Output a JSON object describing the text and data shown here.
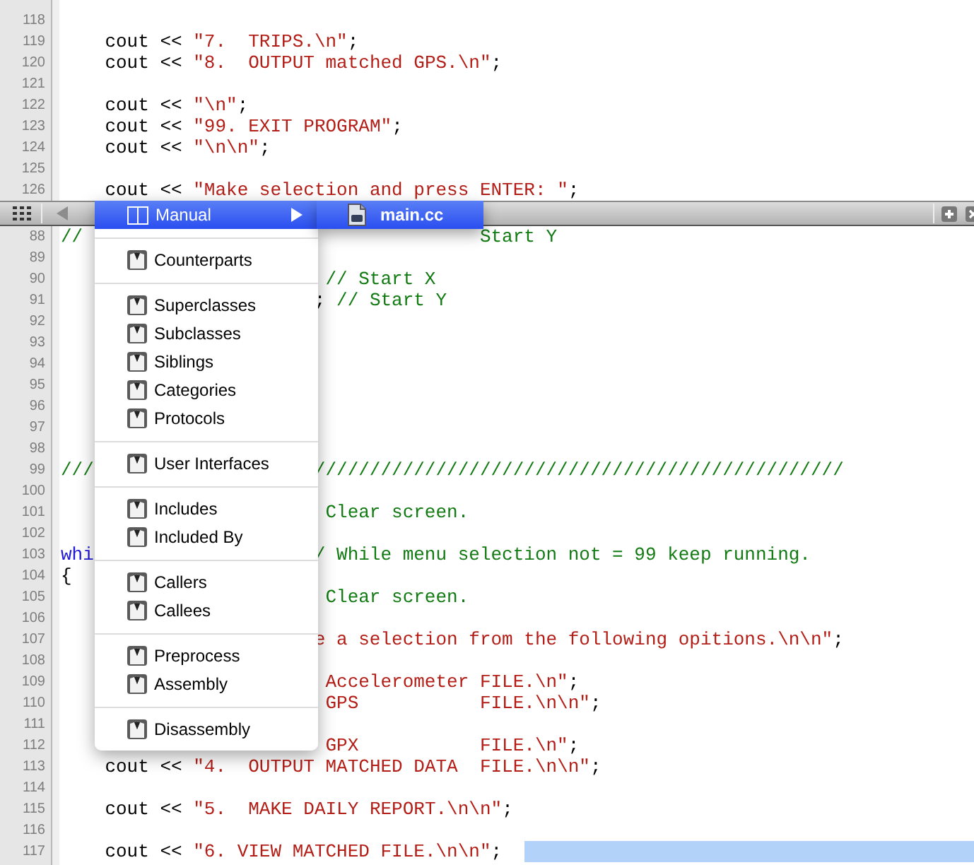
{
  "editor_top": {
    "lines": [
      {
        "number": "118"
      },
      {
        "number": "119",
        "indented": true,
        "segments": [
          {
            "kind": "plain",
            "text": "cout << "
          },
          {
            "kind": "string",
            "text": "\"7.  TRIPS.\\n\""
          },
          {
            "kind": "plain",
            "text": ";"
          }
        ]
      },
      {
        "number": "120",
        "indented": true,
        "segments": [
          {
            "kind": "plain",
            "text": "cout << "
          },
          {
            "kind": "string",
            "text": "\"8.  OUTPUT matched GPS.\\n\""
          },
          {
            "kind": "plain",
            "text": ";"
          }
        ]
      },
      {
        "number": "121"
      },
      {
        "number": "122",
        "indented": true,
        "segments": [
          {
            "kind": "plain",
            "text": "cout << "
          },
          {
            "kind": "string",
            "text": "\"\\n\""
          },
          {
            "kind": "plain",
            "text": ";"
          }
        ]
      },
      {
        "number": "123",
        "indented": true,
        "segments": [
          {
            "kind": "plain",
            "text": "cout << "
          },
          {
            "kind": "string",
            "text": "\"99. EXIT PROGRAM\""
          },
          {
            "kind": "plain",
            "text": ";"
          }
        ]
      },
      {
        "number": "124",
        "indented": true,
        "segments": [
          {
            "kind": "plain",
            "text": "cout << "
          },
          {
            "kind": "string",
            "text": "\"\\n\\n\""
          },
          {
            "kind": "plain",
            "text": ";"
          }
        ]
      },
      {
        "number": "125"
      },
      {
        "number": "126",
        "indented": true,
        "segments": [
          {
            "kind": "plain",
            "text": "cout << "
          },
          {
            "kind": "string",
            "text": "\"Make selection and press ENTER: \""
          },
          {
            "kind": "plain",
            "text": ";"
          }
        ]
      }
    ]
  },
  "editor_bottom": {
    "lines": [
      {
        "number": "88",
        "segments": [
          {
            "kind": "comment",
            "text": "//"
          }
        ],
        "after_submenu": [
          {
            "kind": "comment",
            "text": "Start Y"
          }
        ]
      },
      {
        "number": "89"
      },
      {
        "number": "90",
        "after_menu": [
          {
            "kind": "comment",
            "text": " // Start X"
          }
        ]
      },
      {
        "number": "91",
        "after_menu": [
          {
            "kind": "plain",
            "text": ";"
          },
          {
            "kind": "comment",
            "text": " // Start Y"
          }
        ]
      },
      {
        "number": "92"
      },
      {
        "number": "93"
      },
      {
        "number": "94"
      },
      {
        "number": "95"
      },
      {
        "number": "96"
      },
      {
        "number": "97"
      },
      {
        "number": "98"
      },
      {
        "number": "99",
        "segments": [
          {
            "kind": "comment",
            "text": "///"
          }
        ],
        "after_menu": [
          {
            "kind": "comment",
            "text": "////////////////////////////////////////////////"
          }
        ]
      },
      {
        "number": "100"
      },
      {
        "number": "101",
        "after_menu": [
          {
            "kind": "comment",
            "text": " Clear screen."
          }
        ]
      },
      {
        "number": "102"
      },
      {
        "number": "103",
        "segments": [
          {
            "kind": "keyword",
            "text": "whi"
          }
        ],
        "after_menu": [
          {
            "kind": "comment",
            "text": "/ While menu selection not = 99 keep running."
          }
        ]
      },
      {
        "number": "104",
        "segments": [
          {
            "kind": "plain",
            "text": "{"
          }
        ]
      },
      {
        "number": "105",
        "after_menu": [
          {
            "kind": "comment",
            "text": " Clear screen."
          }
        ]
      },
      {
        "number": "106"
      },
      {
        "number": "107",
        "after_menu": [
          {
            "kind": "string",
            "text": "e a selection from the following opitions.\\n\\n\""
          },
          {
            "kind": "plain",
            "text": ";"
          }
        ]
      },
      {
        "number": "108"
      },
      {
        "number": "109",
        "after_menu": [
          {
            "kind": "string",
            "text": " Accelerometer FILE.\\n\""
          },
          {
            "kind": "plain",
            "text": ";"
          }
        ]
      },
      {
        "number": "110",
        "after_menu": [
          {
            "kind": "string",
            "text": " GPS           FILE.\\n\\n\""
          },
          {
            "kind": "plain",
            "text": ";"
          }
        ]
      },
      {
        "number": "111"
      },
      {
        "number": "112",
        "after_menu": [
          {
            "kind": "string",
            "text": " GPX           FILE.\\n\""
          },
          {
            "kind": "plain",
            "text": ";"
          }
        ]
      },
      {
        "number": "113",
        "indented": true,
        "segments": [
          {
            "kind": "plain",
            "text": "cout << "
          },
          {
            "kind": "string",
            "text": "\"4.  OUTPUT MATCHED DATA  FILE.\\n\\n\""
          },
          {
            "kind": "plain",
            "text": ";"
          }
        ]
      },
      {
        "number": "114"
      },
      {
        "number": "115",
        "indented": true,
        "segments": [
          {
            "kind": "plain",
            "text": "cout << "
          },
          {
            "kind": "string",
            "text": "\"5.  MAKE DAILY REPORT.\\n\\n\""
          },
          {
            "kind": "plain",
            "text": ";"
          }
        ]
      },
      {
        "number": "116"
      },
      {
        "number": "117",
        "indented": true,
        "segments": [
          {
            "kind": "plain",
            "text": "cout << "
          },
          {
            "kind": "string",
            "text": "\"6. VIEW MATCHED FILE.\\n\\n\""
          },
          {
            "kind": "plain",
            "text": ";"
          }
        ],
        "selection": true
      }
    ]
  },
  "context_menu": {
    "items": [
      {
        "kind": "submenu",
        "label": "Manual",
        "selected": true
      },
      {
        "kind": "separator"
      },
      {
        "kind": "item",
        "label": "Counterparts",
        "selected": false
      },
      {
        "kind": "separator"
      },
      {
        "kind": "item",
        "label": "Superclasses",
        "selected": false
      },
      {
        "kind": "item",
        "label": "Subclasses",
        "selected": false
      },
      {
        "kind": "item",
        "label": "Siblings",
        "selected": false
      },
      {
        "kind": "item",
        "label": "Categories",
        "selected": false
      },
      {
        "kind": "item",
        "label": "Protocols",
        "selected": false
      },
      {
        "kind": "separator"
      },
      {
        "kind": "item",
        "label": "User Interfaces",
        "selected": false
      },
      {
        "kind": "separator"
      },
      {
        "kind": "item",
        "label": "Includes",
        "selected": false
      },
      {
        "kind": "item",
        "label": "Included By",
        "selected": false
      },
      {
        "kind": "separator"
      },
      {
        "kind": "item",
        "label": "Callers",
        "selected": false
      },
      {
        "kind": "item",
        "label": "Callees",
        "selected": false
      },
      {
        "kind": "separator"
      },
      {
        "kind": "item",
        "label": "Preprocess",
        "selected": false
      },
      {
        "kind": "item",
        "label": "Assembly",
        "selected": false
      },
      {
        "kind": "separator"
      },
      {
        "kind": "item",
        "label": "Disassembly",
        "selected": false
      }
    ]
  },
  "submenu": {
    "items": [
      {
        "label": "main.cc",
        "selected": true
      }
    ]
  }
}
